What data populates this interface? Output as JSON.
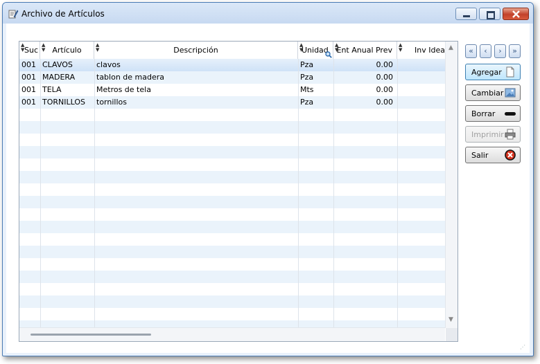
{
  "window": {
    "title": "Archivo de Artículos",
    "icons": {
      "app": "document-pencil-icon",
      "minimize": "minimize-icon",
      "maximize": "restore-icon",
      "close": "close-icon"
    }
  },
  "grid": {
    "columns": [
      {
        "label": "Suc"
      },
      {
        "label": "Artículo"
      },
      {
        "label": "Descripción"
      },
      {
        "label": "Unidad"
      },
      {
        "label": "Ent Anual Prev"
      },
      {
        "label": "Inv Idea"
      }
    ],
    "rows": [
      {
        "suc": "001",
        "articulo": "CLAVOS",
        "descripcion": "clavos",
        "unidad": "Pza",
        "ent_anual_prev": "0.00"
      },
      {
        "suc": "001",
        "articulo": "MADERA",
        "descripcion": "tablon de madera",
        "unidad": "Pza",
        "ent_anual_prev": "0.00"
      },
      {
        "suc": "001",
        "articulo": "TELA",
        "descripcion": "Metros de tela",
        "unidad": "Mts",
        "ent_anual_prev": "0.00"
      },
      {
        "suc": "001",
        "articulo": "TORNILLOS",
        "descripcion": "tornillos",
        "unidad": "Pza",
        "ent_anual_prev": "0.00"
      }
    ],
    "selected_row": 0
  },
  "nav": {
    "first": "«",
    "prev": "‹",
    "next": "›",
    "last": "»"
  },
  "buttons": {
    "agregar": "Agregar",
    "cambiar": "Cambiar",
    "borrar": "Borrar",
    "imprimir": "Imprimir",
    "salir": "Salir"
  },
  "colors": {
    "accent": "#3c7fb1",
    "row_alt": "#eaf3fb",
    "close": "#c2412a"
  }
}
